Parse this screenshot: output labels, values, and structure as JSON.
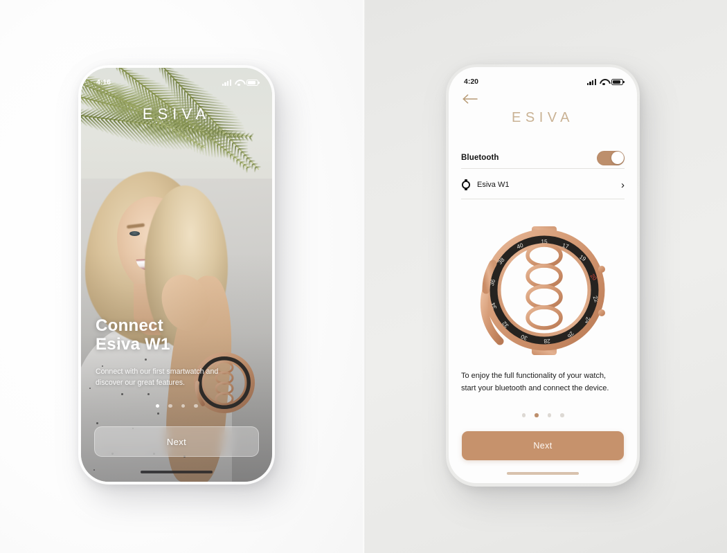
{
  "meta": {
    "scene_title": "Esiva smartwatch app onboarding — two phone mockups",
    "accent_color": "#c6926c",
    "toggle_on_color": "#bd8f6c",
    "brand_gold": "#c9b294"
  },
  "left_phone": {
    "status_bar": {
      "time": "4:16",
      "signal_icon": "signal-bars-icon",
      "wifi_icon": "wifi-icon",
      "battery_icon": "battery-icon"
    },
    "brand": "ESIVA",
    "headline_line1": "Connect",
    "headline_line2": "Esiva W1",
    "subtext": "Connect with our first smartwatch and discover our great features.",
    "pager": {
      "count": 4,
      "active_index": 0
    },
    "next_label": "Next",
    "home_indicator": "home-indicator"
  },
  "right_phone": {
    "status_bar": {
      "time": "4:20",
      "signal_icon": "signal-bars-icon",
      "wifi_icon": "wifi-icon",
      "battery_icon": "battery-icon"
    },
    "back_icon": "back-arrow-icon",
    "brand": "ESIVA",
    "bluetooth": {
      "label": "Bluetooth",
      "state": "on",
      "toggle_icon": "toggle-switch-icon"
    },
    "device": {
      "icon": "watch-icon",
      "name": "Esiva W1",
      "chevron": "›"
    },
    "product_image_alt": "rose-gold Esiva W1 smartwatch",
    "description": "To enjoy the full functionality of your watch, start your bluetooth and connect the device.",
    "pager": {
      "count": 4,
      "active_index": 1
    },
    "next_label": "Next",
    "home_indicator": "home-indicator"
  }
}
